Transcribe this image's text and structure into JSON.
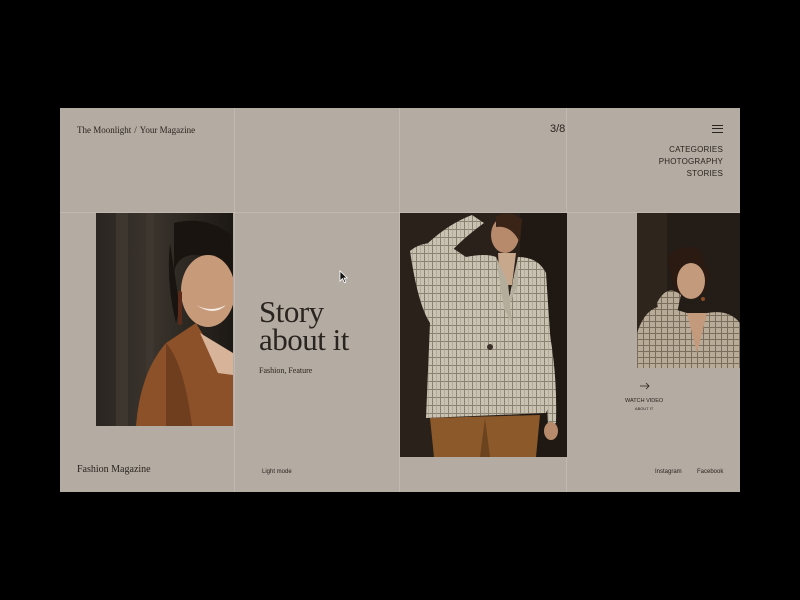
{
  "header": {
    "brand_primary": "The Moonlight",
    "brand_separator": "/",
    "brand_secondary": "Your Magazine",
    "counter": "3/8"
  },
  "nav": {
    "items": [
      "CATEGORIES",
      "PHOTOGRAPHY",
      "STORIES"
    ]
  },
  "hero": {
    "headline_line1": "Story",
    "headline_line2": "about it",
    "subtitle": "Fashion, Feature"
  },
  "video": {
    "label": "WATCH VIDEO",
    "sublabel": "ABOUT IT"
  },
  "footer": {
    "brand": "Fashion Magazine",
    "mode": "Light mode",
    "social": [
      "Instagram",
      "Facebook"
    ]
  },
  "colors": {
    "background": "#b4aba2",
    "text": "#2a2420",
    "frame": "#000000"
  }
}
